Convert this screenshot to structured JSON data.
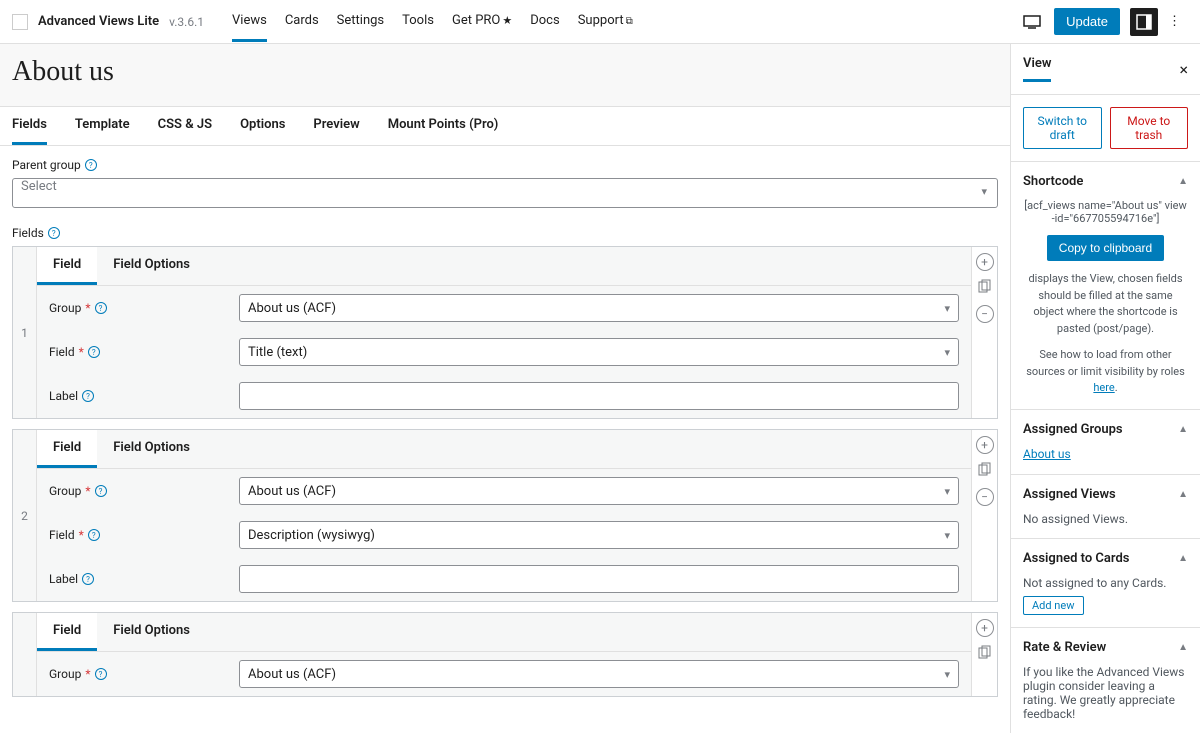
{
  "topbar": {
    "brand": "Advanced Views Lite",
    "version": "v.3.6.1",
    "nav": [
      "Views",
      "Cards",
      "Settings",
      "Tools",
      "Get PRO",
      "Docs",
      "Support"
    ],
    "update": "Update"
  },
  "page": {
    "title": "About us"
  },
  "tabs": [
    "Fields",
    "Template",
    "CSS & JS",
    "Options",
    "Preview",
    "Mount Points (Pro)"
  ],
  "parent_group": {
    "label": "Parent group",
    "placeholder": "Select"
  },
  "fields_label": "Fields",
  "field_tab": {
    "field": "Field",
    "options": "Field Options"
  },
  "row_labels": {
    "group": "Group",
    "field": "Field",
    "label": "Label"
  },
  "rows": [
    {
      "num": "1",
      "group": "About us (ACF)",
      "field": "Title (text)",
      "label": ""
    },
    {
      "num": "2",
      "group": "About us (ACF)",
      "field": "Description (wysiwyg)",
      "label": ""
    },
    {
      "num": "",
      "group": "About us (ACF)",
      "field": "",
      "label": ""
    }
  ],
  "sidebar": {
    "tab": "View",
    "draft": "Switch to draft",
    "trash": "Move to trash",
    "shortcode": {
      "title": "Shortcode",
      "code": "[acf_views name=\"About us\" view-id=\"667705594716e\"]",
      "copy": "Copy to clipboard",
      "desc1": "displays the View, chosen fields should be filled at the same object where the shortcode is pasted (post/page).",
      "desc2_pre": "See how to load from other sources or limit visibility by roles ",
      "desc2_link": "here"
    },
    "assigned_groups": {
      "title": "Assigned Groups",
      "link": "About us"
    },
    "assigned_views": {
      "title": "Assigned Views",
      "text": "No assigned Views."
    },
    "assigned_cards": {
      "title": "Assigned to Cards",
      "text": "Not assigned to any Cards.",
      "add": "Add new"
    },
    "rate": {
      "title": "Rate & Review",
      "text": "If you like the Advanced Views plugin consider leaving a rating. We greatly appreciate feedback!"
    }
  }
}
